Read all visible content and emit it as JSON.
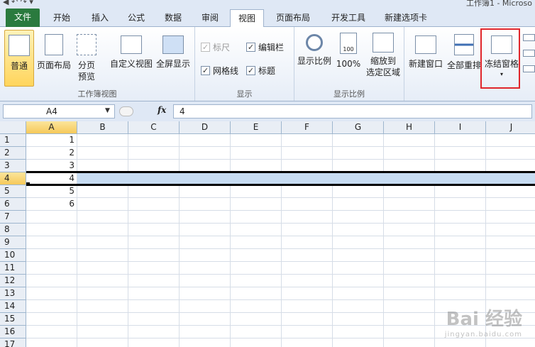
{
  "titlebar": {
    "title": "工作簿1 - Microso"
  },
  "tabs": [
    "文件",
    "开始",
    "插入",
    "公式",
    "数据",
    "审阅",
    "视图",
    "页面布局",
    "开发工具",
    "新建选项卡"
  ],
  "ribbon": {
    "workbook_views": {
      "label": "工作簿视图",
      "normal": "普通",
      "page_layout": "页面布局",
      "page_break": "分页\n预览",
      "custom": "自定义视图",
      "fullscreen": "全屏显示"
    },
    "show": {
      "label": "显示",
      "ruler": "标尺",
      "formula_bar": "编辑栏",
      "gridlines": "网格线",
      "headings": "标题"
    },
    "zoom": {
      "label": "显示比例",
      "zoom": "显示比例",
      "hundred": "100%",
      "to_selection": "缩放到\n选定区域"
    },
    "window": {
      "new_window": "新建窗口",
      "arrange_all": "全部重排",
      "freeze_panes": "冻结窗格"
    }
  },
  "formula_bar": {
    "name_box": "A4",
    "fx": "fx",
    "value": "4"
  },
  "sheet": {
    "columns": [
      "A",
      "B",
      "C",
      "D",
      "E",
      "F",
      "G",
      "H",
      "I",
      "J"
    ],
    "rows": [
      "1",
      "2",
      "3",
      "4",
      "5",
      "6",
      "7",
      "8",
      "9",
      "10",
      "11",
      "12",
      "13",
      "14",
      "15",
      "16",
      "17"
    ],
    "col_a_values": [
      "1",
      "2",
      "3",
      "4",
      "5",
      "6"
    ],
    "selected_cell": "A4"
  },
  "watermark": {
    "main": "Bai 经验",
    "sub": "jingyan.baidu.com"
  },
  "colors": {
    "file_tab": "#2a7a3e",
    "highlight": "#e0262b",
    "row_band": "#c7dcf2",
    "header_selected": "#f6c95a"
  }
}
